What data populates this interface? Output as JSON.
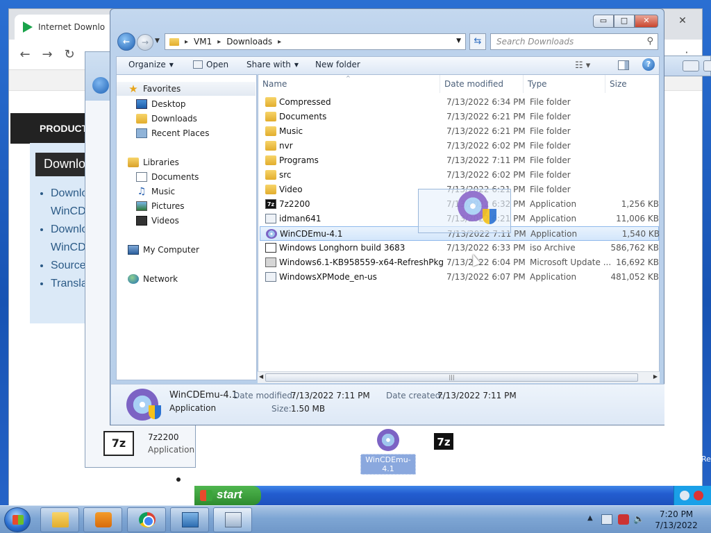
{
  "browser": {
    "tab_title": "Internet Downlo",
    "nav_back": "←",
    "nav_forward": "→",
    "nav_reload": "↻",
    "menu_icon": "⋮",
    "close_icon": "✕",
    "page_nav_label": "PRODUCT",
    "page_heading": "Downlo",
    "page_list": [
      "Downlo",
      "WinCD",
      "Downlo",
      "WinCD",
      "Source",
      "Transla"
    ]
  },
  "background_window": {
    "item_icon_text": "7z",
    "item_name": "7z2200",
    "item_type": "Application"
  },
  "explorer": {
    "caption_buttons": {
      "minimize": "▭",
      "maximize": "□",
      "close": "✕"
    },
    "nav_back_icon": "←",
    "breadcrumb": [
      "VM1",
      "Downloads"
    ],
    "breadcrumb_sep": "▸",
    "search_placeholder": "Search Downloads",
    "commands": {
      "organize": "Organize",
      "open": "Open",
      "share_with": "Share with",
      "new_folder": "New folder",
      "dropdown_arrow": "▼"
    },
    "navigation": {
      "favorites": "Favorites",
      "desktop": "Desktop",
      "downloads": "Downloads",
      "recent_places": "Recent Places",
      "libraries": "Libraries",
      "documents": "Documents",
      "music": "Music",
      "pictures": "Pictures",
      "videos": "Videos",
      "my_computer": "My Computer",
      "network": "Network"
    },
    "columns": {
      "name": "Name",
      "date_modified": "Date modified",
      "type": "Type",
      "size": "Size"
    },
    "files": [
      {
        "name": "Compressed",
        "date": "7/13/2022 6:34 PM",
        "type": "File folder",
        "size": "",
        "icon": "folder-icon"
      },
      {
        "name": "Documents",
        "date": "7/13/2022 6:21 PM",
        "type": "File folder",
        "size": "",
        "icon": "folder-icon"
      },
      {
        "name": "Music",
        "date": "7/13/2022 6:21 PM",
        "type": "File folder",
        "size": "",
        "icon": "folder-icon"
      },
      {
        "name": "nvr",
        "date": "7/13/2022 6:02 PM",
        "type": "File folder",
        "size": "",
        "icon": "folder-icon"
      },
      {
        "name": "Programs",
        "date": "7/13/2022 7:11 PM",
        "type": "File folder",
        "size": "",
        "icon": "folder-icon"
      },
      {
        "name": "src",
        "date": "7/13/2022 6:02 PM",
        "type": "File folder",
        "size": "",
        "icon": "folder-icon"
      },
      {
        "name": "Video",
        "date": "7/13/2022 6:21 PM",
        "type": "File folder",
        "size": "",
        "icon": "folder-icon"
      },
      {
        "name": "7z2200",
        "date": "7/13/2022 6:32 PM",
        "type": "Application",
        "size": "1,256 KB",
        "icon": "7zip-icon"
      },
      {
        "name": "idman641",
        "date": "7/13/2022 6:21 PM",
        "type": "Application",
        "size": "11,006 KB",
        "icon": "application-icon"
      },
      {
        "name": "WinCDEmu-4.1",
        "date": "7/13/2022 7:11 PM",
        "type": "Application",
        "size": "1,540 KB",
        "icon": "cd-disc-icon"
      },
      {
        "name": "Windows Longhorn build 3683",
        "date": "7/13/2022 6:33 PM",
        "type": "iso Archive",
        "size": "586,762 KB",
        "icon": "iso-icon"
      },
      {
        "name": "Windows6.1-KB958559-x64-RefreshPkg",
        "date": "7/13/2022 6:04 PM",
        "type": "Microsoft Update ...",
        "size": "16,692 KB",
        "icon": "update-package-icon"
      },
      {
        "name": "WindowsXPMode_en-us",
        "date": "7/13/2022 6:07 PM",
        "type": "Application",
        "size": "481,052 KB",
        "icon": "application-icon"
      }
    ],
    "selected_index": 9,
    "details": {
      "name": "WinCDEmu-4.1",
      "type": "Application",
      "date_modified_label": "Date modified:",
      "date_modified": "7/13/2022 7:11 PM",
      "date_created_label": "Date created:",
      "date_created": "7/13/2022 7:11 PM",
      "size_label": "Size:",
      "size": "1.50 MB"
    }
  },
  "desktop_icons": [
    {
      "label": "WinCDEmu-4.1",
      "selected": true
    },
    {
      "label": "7z2200",
      "selected": false
    }
  ],
  "desktop_edge_text": "Re",
  "xp_taskbar": {
    "start_label": "start"
  },
  "taskbar": {
    "clock_time": "7:20 PM",
    "clock_date": "7/13/2022"
  }
}
